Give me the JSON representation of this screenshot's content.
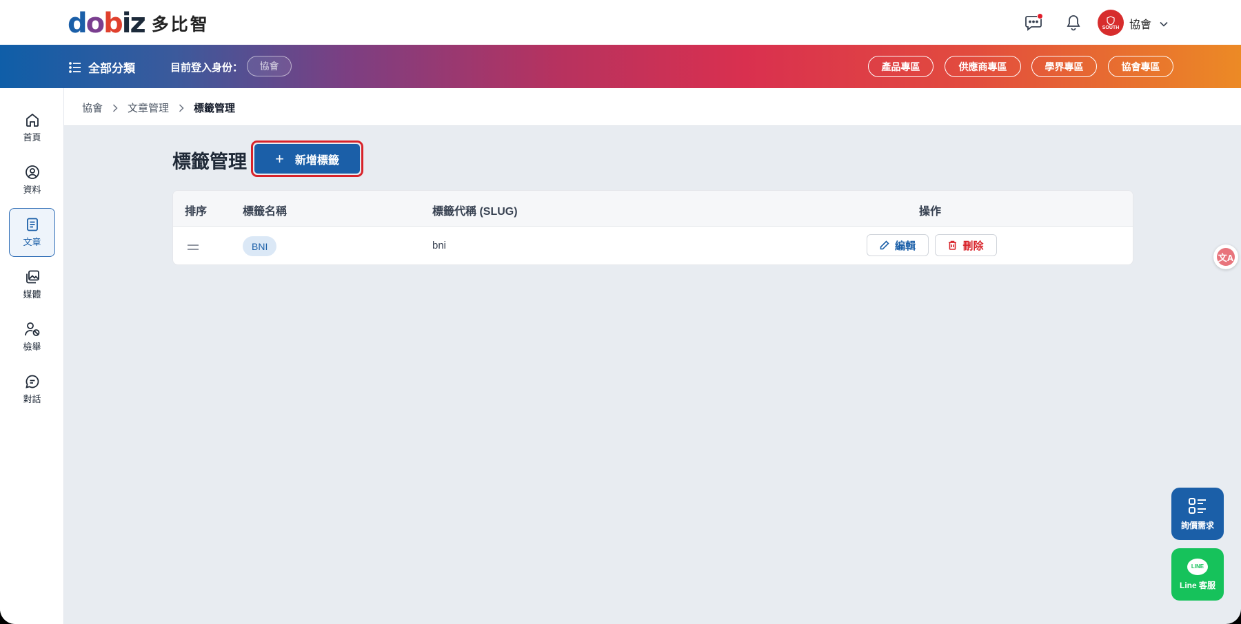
{
  "brand": {
    "logo_mark": "dobiz",
    "logo_text": "多比智"
  },
  "header": {
    "chat_icon": "chat-bubble-icon",
    "bell_icon": "bell-icon",
    "avatar_text": "SOUTH",
    "user_name": "協會",
    "user_caret_icon": "chevron-down-icon",
    "notification_color": "#e11d2a"
  },
  "band": {
    "menu_label": "全部分類",
    "identity_label": "目前登入身份：",
    "identity_value": "協會",
    "zones": [
      "產品專區",
      "供應商專區",
      "學界專區",
      "協會專區"
    ]
  },
  "sidebar": {
    "items": [
      {
        "label": "首頁",
        "icon": "home-icon"
      },
      {
        "label": "資料",
        "icon": "user-circle-icon"
      },
      {
        "label": "文章",
        "icon": "document-icon",
        "active": true
      },
      {
        "label": "媒體",
        "icon": "media-icon"
      },
      {
        "label": "檢舉",
        "icon": "report-user-icon"
      },
      {
        "label": "對話",
        "icon": "chat-icon"
      }
    ]
  },
  "breadcrumb": [
    "協會",
    "文章管理",
    "標籤管理"
  ],
  "page": {
    "title": "標籤管理",
    "add_button": "新增標籤"
  },
  "table": {
    "headers": [
      "排序",
      "標籤名稱",
      "標籤代稱 (SLUG)",
      "操作"
    ],
    "rows": [
      {
        "name": "BNI",
        "slug": "bni",
        "edit": "編輯",
        "delete": "刪除"
      }
    ]
  },
  "floating": {
    "translate_label": "文A",
    "quote_label": "詢價需求",
    "line_badge": "LINE",
    "line_label": "Line 客服"
  },
  "colors": {
    "primary": "#1b5fa8",
    "danger": "#d8232a",
    "line_green": "#16c25b",
    "background": "#e8ecf1"
  }
}
